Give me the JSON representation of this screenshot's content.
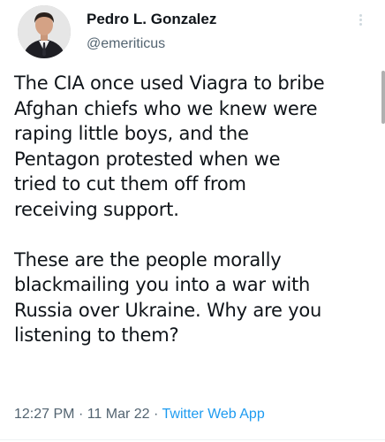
{
  "author": {
    "display_name": "Pedro L. Gonzalez",
    "handle": "@emeriticus"
  },
  "tweet": {
    "paragraphs": [
      [
        "The CIA once used Viagra to bribe",
        "Afghan chiefs who we knew were",
        "raping little boys, and the",
        "Pentagon protested when we",
        "tried to cut them off from",
        "receiving support."
      ],
      [
        "These are the people morally",
        "blackmailing you into a war with",
        "Russia over Ukraine. Why are you",
        "listening to them?"
      ]
    ],
    "time": "12:27 PM",
    "date": "11 Mar 22",
    "source_app": "Twitter Web App",
    "separator": "·"
  },
  "icons": {
    "more": "more-vertical-icon"
  },
  "colors": {
    "text": "#0f1419",
    "secondary": "#536471",
    "link": "#1d9bf0"
  }
}
